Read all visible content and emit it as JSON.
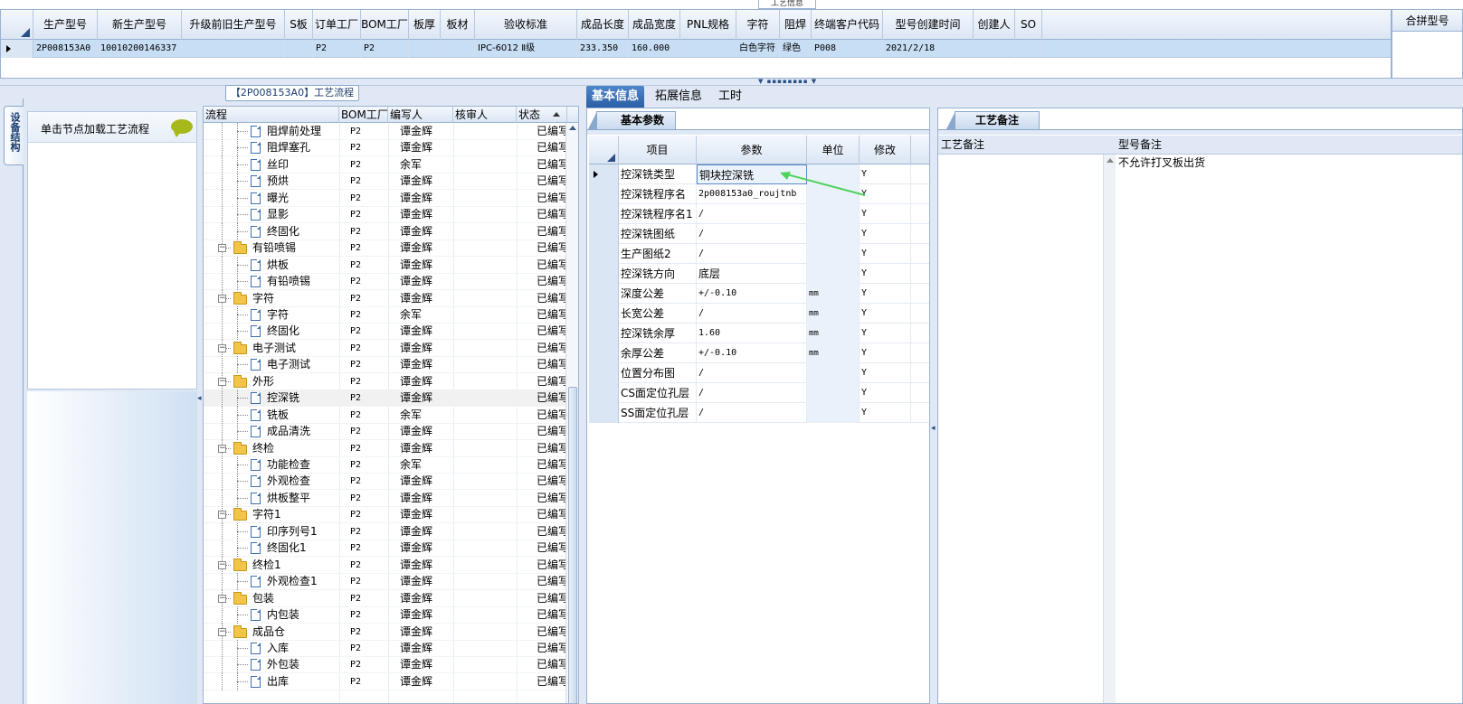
{
  "top_tab_tip": "工艺信息",
  "top_grid": {
    "columns": [
      "生产型号",
      "新生产型号",
      "升级前旧生产型号",
      "S板",
      "订单工厂",
      "BOM工厂",
      "板厚",
      "板材",
      "验收标准",
      "成品长度",
      "成品宽度",
      "PNL规格",
      "字符",
      "阻焊",
      "终端客户代码",
      "型号创建时间",
      "创建人",
      "SO"
    ],
    "row": [
      "2P008153A0",
      "10010200146337",
      "",
      "",
      "P2",
      "P2",
      "",
      "",
      "IPC-6012 Ⅱ级",
      "233.350",
      "160.000",
      "",
      "白色字符",
      "绿色",
      "P008",
      "2021/2/18",
      "",
      ""
    ]
  },
  "merge_panel": {
    "header": "合拼型号"
  },
  "splitter_grip": "▼ ▪▪▪▪▪▪▪▪ ▼",
  "left_vtab": {
    "label": "设备结构"
  },
  "node_panel": {
    "hint": "单击节点加载工艺流程"
  },
  "tree": {
    "title": "【2P008153A0】工艺流程",
    "columns": [
      "流程",
      "BOM工厂",
      "编写人",
      "核审人",
      "状态"
    ],
    "rows": [
      {
        "name": "阻焊前处理",
        "level": 2,
        "bom": "P2",
        "writer": "谭金辉",
        "status": "已编写"
      },
      {
        "name": "阻焊塞孔",
        "level": 2,
        "bom": "P2",
        "writer": "谭金辉",
        "status": "已编写"
      },
      {
        "name": "丝印",
        "level": 2,
        "bom": "P2",
        "writer": "余军",
        "status": "已编写"
      },
      {
        "name": "预烘",
        "level": 2,
        "bom": "P2",
        "writer": "谭金辉",
        "status": "已编写"
      },
      {
        "name": "曝光",
        "level": 2,
        "bom": "P2",
        "writer": "谭金辉",
        "status": "已编写"
      },
      {
        "name": "显影",
        "level": 2,
        "bom": "P2",
        "writer": "谭金辉",
        "status": "已编写"
      },
      {
        "name": "终固化",
        "level": 2,
        "bom": "P2",
        "writer": "谭金辉",
        "status": "已编写"
      },
      {
        "name": "有铅喷锡",
        "level": 1,
        "bom": "P2",
        "writer": "谭金辉",
        "status": "已编写"
      },
      {
        "name": "烘板",
        "level": 2,
        "bom": "P2",
        "writer": "谭金辉",
        "status": "已编写"
      },
      {
        "name": "有铅喷锡",
        "level": 2,
        "bom": "P2",
        "writer": "谭金辉",
        "status": "已编写"
      },
      {
        "name": "字符",
        "level": 1,
        "bom": "P2",
        "writer": "谭金辉",
        "status": "已编写"
      },
      {
        "name": "字符",
        "level": 2,
        "bom": "P2",
        "writer": "余军",
        "status": "已编写"
      },
      {
        "name": "终固化",
        "level": 2,
        "bom": "P2",
        "writer": "谭金辉",
        "status": "已编写"
      },
      {
        "name": "电子测试",
        "level": 1,
        "bom": "P2",
        "writer": "谭金辉",
        "status": "已编写"
      },
      {
        "name": "电子测试",
        "level": 2,
        "bom": "P2",
        "writer": "谭金辉",
        "status": "已编写"
      },
      {
        "name": "外形",
        "level": 1,
        "bom": "P2",
        "writer": "谭金辉",
        "status": "已编写"
      },
      {
        "name": "控深铣",
        "level": 2,
        "bom": "P2",
        "writer": "谭金辉",
        "status": "已编写",
        "selected": true
      },
      {
        "name": "铣板",
        "level": 2,
        "bom": "P2",
        "writer": "余军",
        "status": "已编写"
      },
      {
        "name": "成品清洗",
        "level": 2,
        "bom": "P2",
        "writer": "谭金辉",
        "status": "已编写"
      },
      {
        "name": "终检",
        "level": 1,
        "bom": "P2",
        "writer": "谭金辉",
        "status": "已编写"
      },
      {
        "name": "功能检查",
        "level": 2,
        "bom": "P2",
        "writer": "余军",
        "status": "已编写"
      },
      {
        "name": "外观检查",
        "level": 2,
        "bom": "P2",
        "writer": "谭金辉",
        "status": "已编写"
      },
      {
        "name": "烘板整平",
        "level": 2,
        "bom": "P2",
        "writer": "谭金辉",
        "status": "已编写"
      },
      {
        "name": "字符1",
        "level": 1,
        "bom": "P2",
        "writer": "谭金辉",
        "status": "已编写"
      },
      {
        "name": "印序列号1",
        "level": 2,
        "bom": "P2",
        "writer": "谭金辉",
        "status": "已编写"
      },
      {
        "name": "终固化1",
        "level": 2,
        "bom": "P2",
        "writer": "谭金辉",
        "status": "已编写"
      },
      {
        "name": "终检1",
        "level": 1,
        "bom": "P2",
        "writer": "谭金辉",
        "status": "已编写"
      },
      {
        "name": "外观检查1",
        "level": 2,
        "bom": "P2",
        "writer": "谭金辉",
        "status": "已编写"
      },
      {
        "name": "包装",
        "level": 1,
        "bom": "P2",
        "writer": "谭金辉",
        "status": "已编写"
      },
      {
        "name": "内包装",
        "level": 2,
        "bom": "P2",
        "writer": "谭金辉",
        "status": "已编写"
      },
      {
        "name": "成品仓",
        "level": 1,
        "bom": "P2",
        "writer": "谭金辉",
        "status": "已编写"
      },
      {
        "name": "入库",
        "level": 2,
        "bom": "P2",
        "writer": "谭金辉",
        "status": "已编写"
      },
      {
        "name": "外包装",
        "level": 2,
        "bom": "P2",
        "writer": "谭金辉",
        "status": "已编写"
      },
      {
        "name": "出库",
        "level": 2,
        "bom": "P2",
        "writer": "谭金辉",
        "status": "已编写"
      }
    ]
  },
  "main_tabs": [
    "基本信息",
    "拓展信息",
    "工时"
  ],
  "basic": {
    "subtab": "基本参数",
    "columns": [
      "项目",
      "参数",
      "单位",
      "修改"
    ],
    "rows": [
      {
        "item": "控深铣类型",
        "param": "铜块控深铣",
        "unit": "",
        "mod": "Y",
        "current": true
      },
      {
        "item": "控深铣程序名",
        "param": "2p008153a0_roujtnb",
        "unit": "",
        "mod": "Y"
      },
      {
        "item": "控深铣程序名1",
        "param": "/",
        "unit": "",
        "mod": "Y"
      },
      {
        "item": "控深铣图纸",
        "param": "/",
        "unit": "",
        "mod": "Y"
      },
      {
        "item": "生产图纸2",
        "param": "/",
        "unit": "",
        "mod": "Y"
      },
      {
        "item": "控深铣方向",
        "param": "底层",
        "unit": "",
        "mod": "Y"
      },
      {
        "item": "深度公差",
        "param": "+/-0.10",
        "unit": "mm",
        "mod": "Y"
      },
      {
        "item": "长宽公差",
        "param": "/",
        "unit": "mm",
        "mod": "Y"
      },
      {
        "item": "控深铣余厚",
        "param": "1.60",
        "unit": "mm",
        "mod": "Y"
      },
      {
        "item": "余厚公差",
        "param": "+/-0.10",
        "unit": "mm",
        "mod": "Y"
      },
      {
        "item": "位置分布图",
        "param": "/",
        "unit": "",
        "mod": "Y"
      },
      {
        "item": "CS面定位孔层",
        "param": "/",
        "unit": "",
        "mod": "Y"
      },
      {
        "item": "SS面定位孔层",
        "param": "/",
        "unit": "",
        "mod": "Y"
      }
    ]
  },
  "notes": {
    "subtab": "工艺备注",
    "columns": [
      "工艺备注",
      "型号备注"
    ],
    "model_note": "不允许打叉板出货"
  },
  "colors": {
    "accent": "#2b5fa6",
    "selection": "#c7def5",
    "arrow": "#4cd35a"
  }
}
